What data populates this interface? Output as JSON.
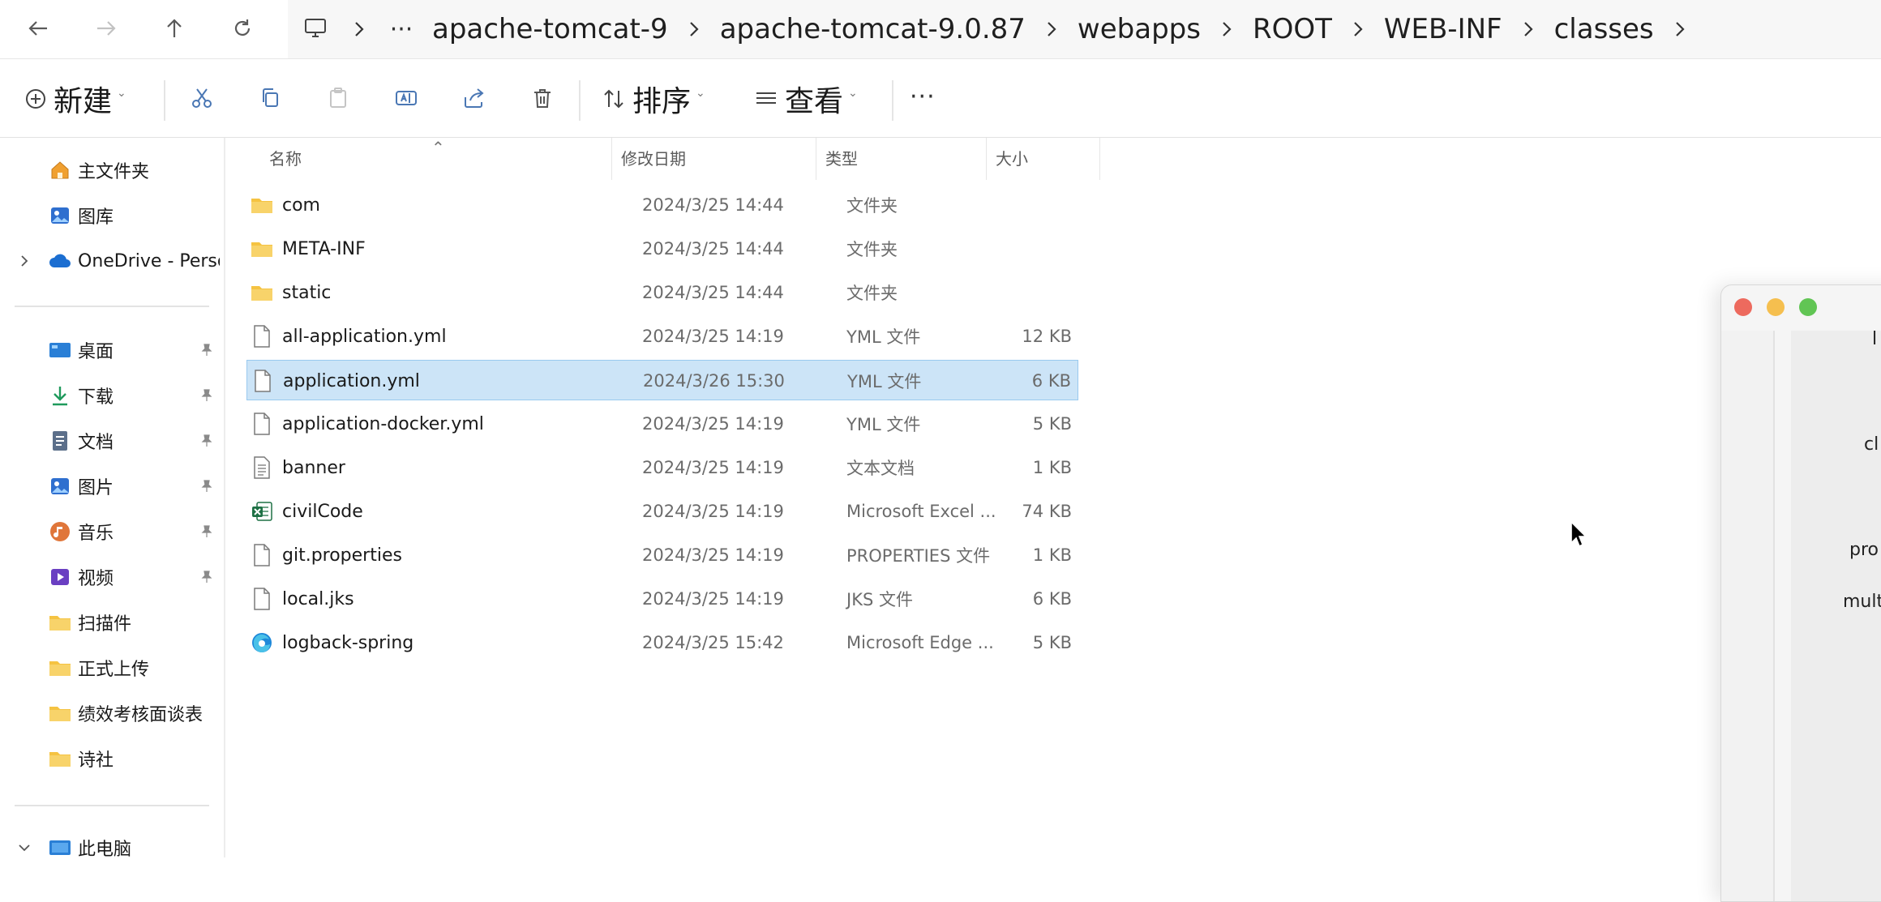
{
  "nav": {
    "back_icon": "arrow-left-icon",
    "forward_icon": "arrow-right-icon",
    "up_icon": "arrow-up-icon",
    "refresh_icon": "refresh-icon"
  },
  "breadcrumb": {
    "overflow": "···",
    "items": [
      "apache-tomcat-9",
      "apache-tomcat-9.0.87",
      "webapps",
      "ROOT",
      "WEB-INF",
      "classes"
    ]
  },
  "toolbar": {
    "new_label": "新建",
    "sort_label": "排序",
    "view_label": "查看",
    "more_label": "···"
  },
  "sidebar": {
    "home": "主文件夹",
    "gallery": "图库",
    "onedrive": "OneDrive - Perso",
    "desktop": "桌面",
    "downloads": "下载",
    "documents": "文档",
    "pictures": "图片",
    "music": "音乐",
    "videos": "视频",
    "folder1": "扫描件",
    "folder2": "正式上传",
    "folder3": "绩效考核面谈表",
    "folder4": "诗社",
    "this_pc": "此电脑"
  },
  "columns": {
    "name": "名称",
    "modified": "修改日期",
    "type": "类型",
    "size": "大小"
  },
  "files": [
    {
      "name": "com",
      "date": "2024/3/25 14:44",
      "type": "文件夹",
      "size": "",
      "icon": "folder-icon"
    },
    {
      "name": "META-INF",
      "date": "2024/3/25 14:44",
      "type": "文件夹",
      "size": "",
      "icon": "folder-icon"
    },
    {
      "name": "static",
      "date": "2024/3/25 14:44",
      "type": "文件夹",
      "size": "",
      "icon": "folder-icon"
    },
    {
      "name": "all-application.yml",
      "date": "2024/3/25 14:19",
      "type": "YML 文件",
      "size": "12 KB",
      "icon": "file-icon"
    },
    {
      "name": "application.yml",
      "date": "2024/3/26 15:30",
      "type": "YML 文件",
      "size": "6 KB",
      "icon": "file-icon"
    },
    {
      "name": "application-docker.yml",
      "date": "2024/3/25 14:19",
      "type": "YML 文件",
      "size": "5 KB",
      "icon": "file-icon"
    },
    {
      "name": "banner",
      "date": "2024/3/25 14:19",
      "type": "文本文档",
      "size": "1 KB",
      "icon": "text-file-icon"
    },
    {
      "name": "civilCode",
      "date": "2024/3/25 14:19",
      "type": "Microsoft Excel ...",
      "size": "74 KB",
      "icon": "excel-icon"
    },
    {
      "name": "git.properties",
      "date": "2024/3/25 14:19",
      "type": "PROPERTIES 文件",
      "size": "1 KB",
      "icon": "file-icon"
    },
    {
      "name": "local.jks",
      "date": "2024/3/25 14:19",
      "type": "JKS 文件",
      "size": "6 KB",
      "icon": "file-icon"
    },
    {
      "name": "logback-spring",
      "date": "2024/3/25 15:42",
      "type": "Microsoft Edge ...",
      "size": "5 KB",
      "icon": "edge-icon"
    }
  ],
  "selected_file": "application.yml",
  "other_window": {
    "lines": [
      "l",
      "cl",
      "pro",
      "mult"
    ]
  },
  "colors": {
    "selection": "#cce4f7",
    "folder": "#f5c342",
    "close": "#ed6a5e",
    "minimize": "#f5bf4f",
    "zoom": "#61c554"
  }
}
